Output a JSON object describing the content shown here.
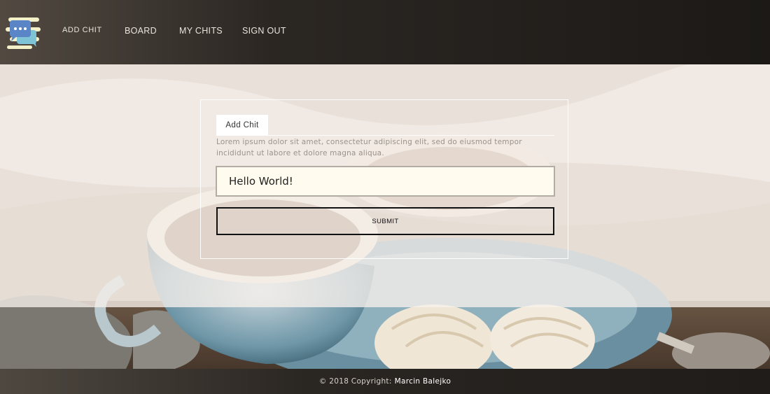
{
  "header": {
    "logo_icon": "chat-bubbles-icon",
    "nav": {
      "add_chit": "ADD CHIT",
      "board": "BOARD",
      "my_chits": "MY CHITS",
      "sign_out": "SIGN OUT"
    }
  },
  "form": {
    "tab_label": "Add Chit",
    "description": "Lorem ipsum dolor sit amet, consectetur adipiscing elit, sed do eiusmod tempor incididunt ut labore et dolore magna aliqua.",
    "input_value": "Hello World!",
    "submit_label": "SUBMIT"
  },
  "footer": {
    "copyright": "© 2018 Copyright:",
    "author": "Marcin Balejko"
  },
  "colors": {
    "header_bg": "#1c1917",
    "overlay": "#f7f1ec",
    "input_bg": "#fffbef",
    "footer_bg": "#1f1c1a"
  }
}
